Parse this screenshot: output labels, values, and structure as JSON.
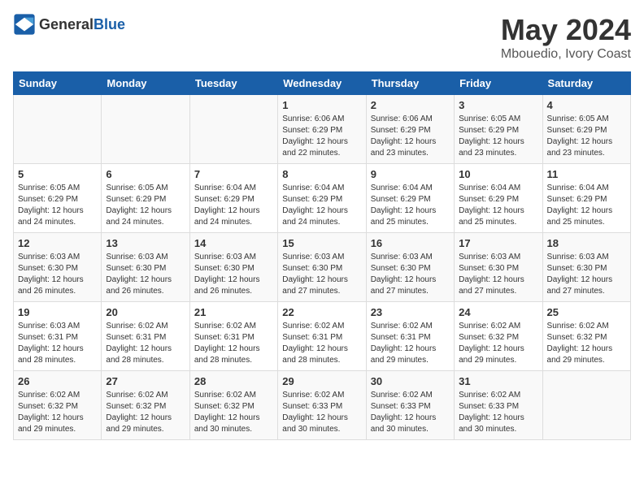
{
  "logo": {
    "text_general": "General",
    "text_blue": "Blue"
  },
  "header": {
    "month_year": "May 2024",
    "location": "Mbouedio, Ivory Coast"
  },
  "days_of_week": [
    "Sunday",
    "Monday",
    "Tuesday",
    "Wednesday",
    "Thursday",
    "Friday",
    "Saturday"
  ],
  "weeks": [
    {
      "days": [
        {
          "num": "",
          "info": ""
        },
        {
          "num": "",
          "info": ""
        },
        {
          "num": "",
          "info": ""
        },
        {
          "num": "1",
          "info": "Sunrise: 6:06 AM\nSunset: 6:29 PM\nDaylight: 12 hours\nand 22 minutes."
        },
        {
          "num": "2",
          "info": "Sunrise: 6:06 AM\nSunset: 6:29 PM\nDaylight: 12 hours\nand 23 minutes."
        },
        {
          "num": "3",
          "info": "Sunrise: 6:05 AM\nSunset: 6:29 PM\nDaylight: 12 hours\nand 23 minutes."
        },
        {
          "num": "4",
          "info": "Sunrise: 6:05 AM\nSunset: 6:29 PM\nDaylight: 12 hours\nand 23 minutes."
        }
      ]
    },
    {
      "days": [
        {
          "num": "5",
          "info": "Sunrise: 6:05 AM\nSunset: 6:29 PM\nDaylight: 12 hours\nand 24 minutes."
        },
        {
          "num": "6",
          "info": "Sunrise: 6:05 AM\nSunset: 6:29 PM\nDaylight: 12 hours\nand 24 minutes."
        },
        {
          "num": "7",
          "info": "Sunrise: 6:04 AM\nSunset: 6:29 PM\nDaylight: 12 hours\nand 24 minutes."
        },
        {
          "num": "8",
          "info": "Sunrise: 6:04 AM\nSunset: 6:29 PM\nDaylight: 12 hours\nand 24 minutes."
        },
        {
          "num": "9",
          "info": "Sunrise: 6:04 AM\nSunset: 6:29 PM\nDaylight: 12 hours\nand 25 minutes."
        },
        {
          "num": "10",
          "info": "Sunrise: 6:04 AM\nSunset: 6:29 PM\nDaylight: 12 hours\nand 25 minutes."
        },
        {
          "num": "11",
          "info": "Sunrise: 6:04 AM\nSunset: 6:29 PM\nDaylight: 12 hours\nand 25 minutes."
        }
      ]
    },
    {
      "days": [
        {
          "num": "12",
          "info": "Sunrise: 6:03 AM\nSunset: 6:30 PM\nDaylight: 12 hours\nand 26 minutes."
        },
        {
          "num": "13",
          "info": "Sunrise: 6:03 AM\nSunset: 6:30 PM\nDaylight: 12 hours\nand 26 minutes."
        },
        {
          "num": "14",
          "info": "Sunrise: 6:03 AM\nSunset: 6:30 PM\nDaylight: 12 hours\nand 26 minutes."
        },
        {
          "num": "15",
          "info": "Sunrise: 6:03 AM\nSunset: 6:30 PM\nDaylight: 12 hours\nand 27 minutes."
        },
        {
          "num": "16",
          "info": "Sunrise: 6:03 AM\nSunset: 6:30 PM\nDaylight: 12 hours\nand 27 minutes."
        },
        {
          "num": "17",
          "info": "Sunrise: 6:03 AM\nSunset: 6:30 PM\nDaylight: 12 hours\nand 27 minutes."
        },
        {
          "num": "18",
          "info": "Sunrise: 6:03 AM\nSunset: 6:30 PM\nDaylight: 12 hours\nand 27 minutes."
        }
      ]
    },
    {
      "days": [
        {
          "num": "19",
          "info": "Sunrise: 6:03 AM\nSunset: 6:31 PM\nDaylight: 12 hours\nand 28 minutes."
        },
        {
          "num": "20",
          "info": "Sunrise: 6:02 AM\nSunset: 6:31 PM\nDaylight: 12 hours\nand 28 minutes."
        },
        {
          "num": "21",
          "info": "Sunrise: 6:02 AM\nSunset: 6:31 PM\nDaylight: 12 hours\nand 28 minutes."
        },
        {
          "num": "22",
          "info": "Sunrise: 6:02 AM\nSunset: 6:31 PM\nDaylight: 12 hours\nand 28 minutes."
        },
        {
          "num": "23",
          "info": "Sunrise: 6:02 AM\nSunset: 6:31 PM\nDaylight: 12 hours\nand 29 minutes."
        },
        {
          "num": "24",
          "info": "Sunrise: 6:02 AM\nSunset: 6:32 PM\nDaylight: 12 hours\nand 29 minutes."
        },
        {
          "num": "25",
          "info": "Sunrise: 6:02 AM\nSunset: 6:32 PM\nDaylight: 12 hours\nand 29 minutes."
        }
      ]
    },
    {
      "days": [
        {
          "num": "26",
          "info": "Sunrise: 6:02 AM\nSunset: 6:32 PM\nDaylight: 12 hours\nand 29 minutes."
        },
        {
          "num": "27",
          "info": "Sunrise: 6:02 AM\nSunset: 6:32 PM\nDaylight: 12 hours\nand 29 minutes."
        },
        {
          "num": "28",
          "info": "Sunrise: 6:02 AM\nSunset: 6:32 PM\nDaylight: 12 hours\nand 30 minutes."
        },
        {
          "num": "29",
          "info": "Sunrise: 6:02 AM\nSunset: 6:33 PM\nDaylight: 12 hours\nand 30 minutes."
        },
        {
          "num": "30",
          "info": "Sunrise: 6:02 AM\nSunset: 6:33 PM\nDaylight: 12 hours\nand 30 minutes."
        },
        {
          "num": "31",
          "info": "Sunrise: 6:02 AM\nSunset: 6:33 PM\nDaylight: 12 hours\nand 30 minutes."
        },
        {
          "num": "",
          "info": ""
        }
      ]
    }
  ]
}
